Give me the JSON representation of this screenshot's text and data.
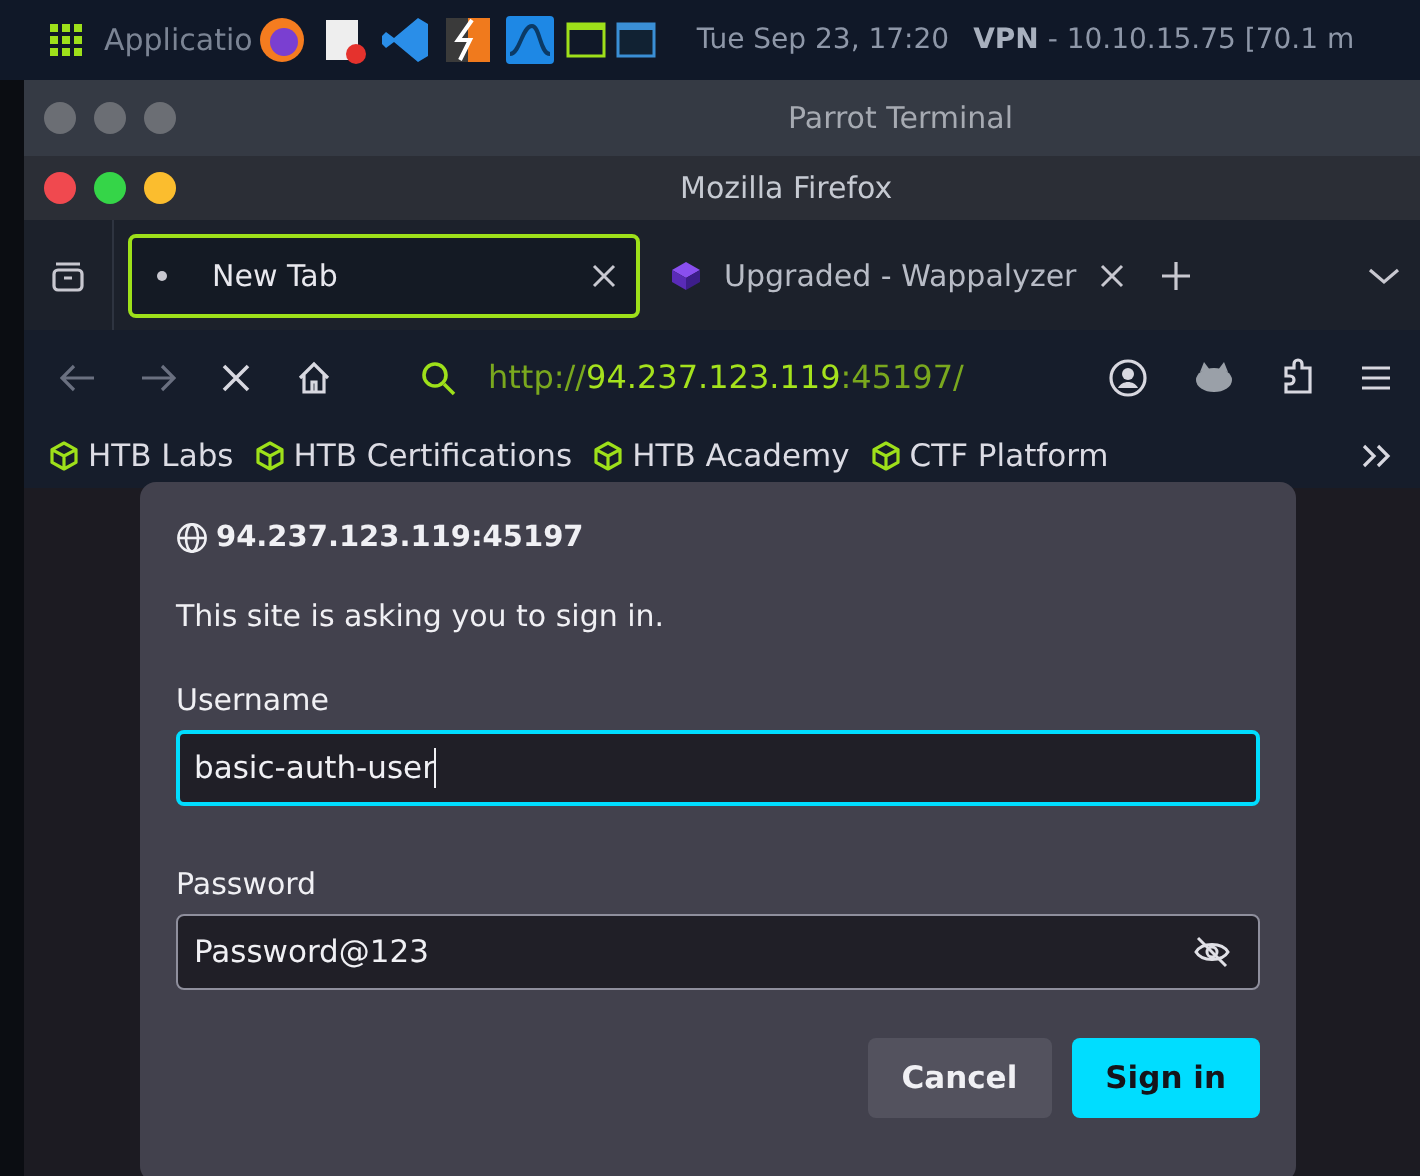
{
  "taskbar": {
    "apps_label": "Applicatio",
    "clock": "Tue Sep 23, 17:20",
    "vpn": "**VPN** - 10.10.15.75 [70.1 m"
  },
  "background_window": {
    "title": "Parrot Terminal"
  },
  "window": {
    "title": "Mozilla Firefox"
  },
  "tabs": [
    {
      "label": "New Tab",
      "selected": true
    },
    {
      "label": "Upgraded - Wappalyzer",
      "selected": false
    }
  ],
  "address_bar": {
    "scheme": "http://",
    "host": "94.237.123.119",
    "port": ":45197/"
  },
  "bookmarks": [
    "HTB Labs",
    "HTB Certifications",
    "HTB Academy",
    "CTF Platform"
  ],
  "dialog": {
    "origin": "94.237.123.119:45197",
    "message": "This site is asking you to sign in.",
    "fields": [
      {
        "label": "Username",
        "value": "basic-auth-user",
        "focused": true,
        "kind": "text"
      },
      {
        "label": "Password",
        "value": "Password@123",
        "focused": false,
        "kind": "revealed-password"
      }
    ],
    "buttons": [
      {
        "label": "Cancel",
        "kind": "secondary"
      },
      {
        "label": "Sign in",
        "kind": "primary"
      }
    ]
  }
}
